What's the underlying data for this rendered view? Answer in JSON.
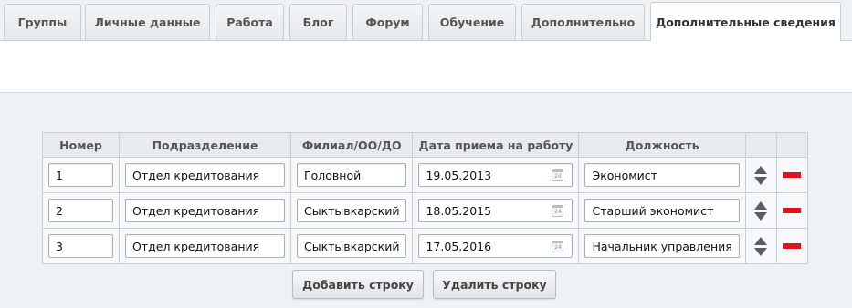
{
  "tabs": [
    {
      "label": "Группы",
      "active": false
    },
    {
      "label": "Личные данные",
      "active": false
    },
    {
      "label": "Работа",
      "active": false
    },
    {
      "label": "Блог",
      "active": false
    },
    {
      "label": "Форум",
      "active": false
    },
    {
      "label": "Обучение",
      "active": false
    },
    {
      "label": "Дополнительно",
      "active": false
    },
    {
      "label": "Дополнительные сведения",
      "active": true
    }
  ],
  "table": {
    "headers": [
      "Номер",
      "Подразделение",
      "Филиал/ОО/ДО",
      "Дата приема на работу",
      "Должность"
    ],
    "rows": [
      {
        "number": "1",
        "department": "Отдел кредитования",
        "branch": "Головной",
        "hire_date": "19.05.2013",
        "position": "Экономист"
      },
      {
        "number": "2",
        "department": "Отдел кредитования",
        "branch": "Сыктывкарский",
        "hire_date": "18.05.2015",
        "position": "Старший экономист"
      },
      {
        "number": "3",
        "department": "Отдел кредитования",
        "branch": "Сыктывкарский",
        "hire_date": "17.05.2016",
        "position": "Начальник управления"
      }
    ],
    "calendar_icon_text": "24"
  },
  "buttons": {
    "add_row": "Добавить строку",
    "delete_row": "Удалить строку"
  },
  "colors": {
    "remove_marker": "#e0121c",
    "arrow": "#5a5e61"
  }
}
